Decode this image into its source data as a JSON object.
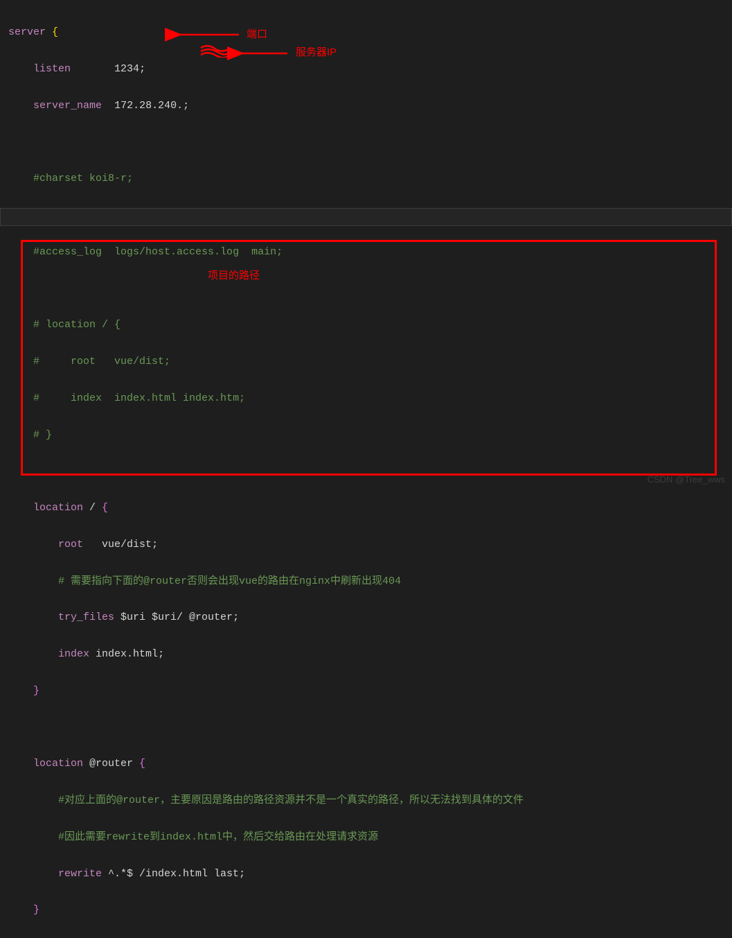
{
  "code": {
    "l1": {
      "server": "server",
      "brace_open": "{"
    },
    "l2": {
      "indent": "    ",
      "listen": "listen",
      "gap": "       ",
      "value": "1234",
      "semi": ";"
    },
    "l3": {
      "indent": "    ",
      "server_name": "server_name",
      "gap": "  ",
      "value": "172.28.240.",
      "semi": ";"
    },
    "l5": {
      "indent": "    ",
      "text": "#charset koi8-r;"
    },
    "l7": {
      "indent": "    ",
      "text": "#access_log  logs/host.access.log  main;"
    },
    "l9": {
      "indent": "    ",
      "text": "# location / {"
    },
    "l10": {
      "indent": "    ",
      "text": "#     root   vue/dist;"
    },
    "l11": {
      "indent": "    ",
      "text": "#     index  index.html index.htm;"
    },
    "l12": {
      "indent": "    ",
      "text": "# }"
    },
    "l14": {
      "indent": "    ",
      "location": "location",
      "path": " / ",
      "brace": "{"
    },
    "l15": {
      "indent": "        ",
      "root": "root",
      "gap": "   ",
      "value": "vue/dist",
      "semi": ";"
    },
    "l16": {
      "indent": "        ",
      "text": "# 需要指向下面的@router否则会出现vue的路由在nginx中刷新出现404"
    },
    "l17": {
      "indent": "        ",
      "try_files": "try_files",
      "args": " $uri $uri/ @router",
      "semi": ";"
    },
    "l18": {
      "indent": "        ",
      "index_kw": "index",
      "gap": " ",
      "value": "index.html",
      "semi": ";"
    },
    "l19": {
      "indent": "    ",
      "brace": "}"
    },
    "l21": {
      "indent": "    ",
      "location": "location",
      "path": " @router ",
      "brace": "{"
    },
    "l22": {
      "indent": "        ",
      "text": "#对应上面的@router，主要原因是路由的路径资源并不是一个真实的路径，所以无法找到具体的文件"
    },
    "l23": {
      "indent": "        ",
      "text": "#因此需要rewrite到index.html中，然后交给路由在处理请求资源"
    },
    "l24": {
      "indent": "        ",
      "rewrite": "rewrite",
      "pattern": " ^.*$ /index.html last",
      "semi": ";"
    },
    "l25": {
      "indent": "    ",
      "brace": "}"
    }
  },
  "annotations": {
    "port_label": "端口",
    "server_ip_label": "服务器IP",
    "project_path_label": "项目的路径"
  },
  "watermark": "CSDN @Tree_wws"
}
